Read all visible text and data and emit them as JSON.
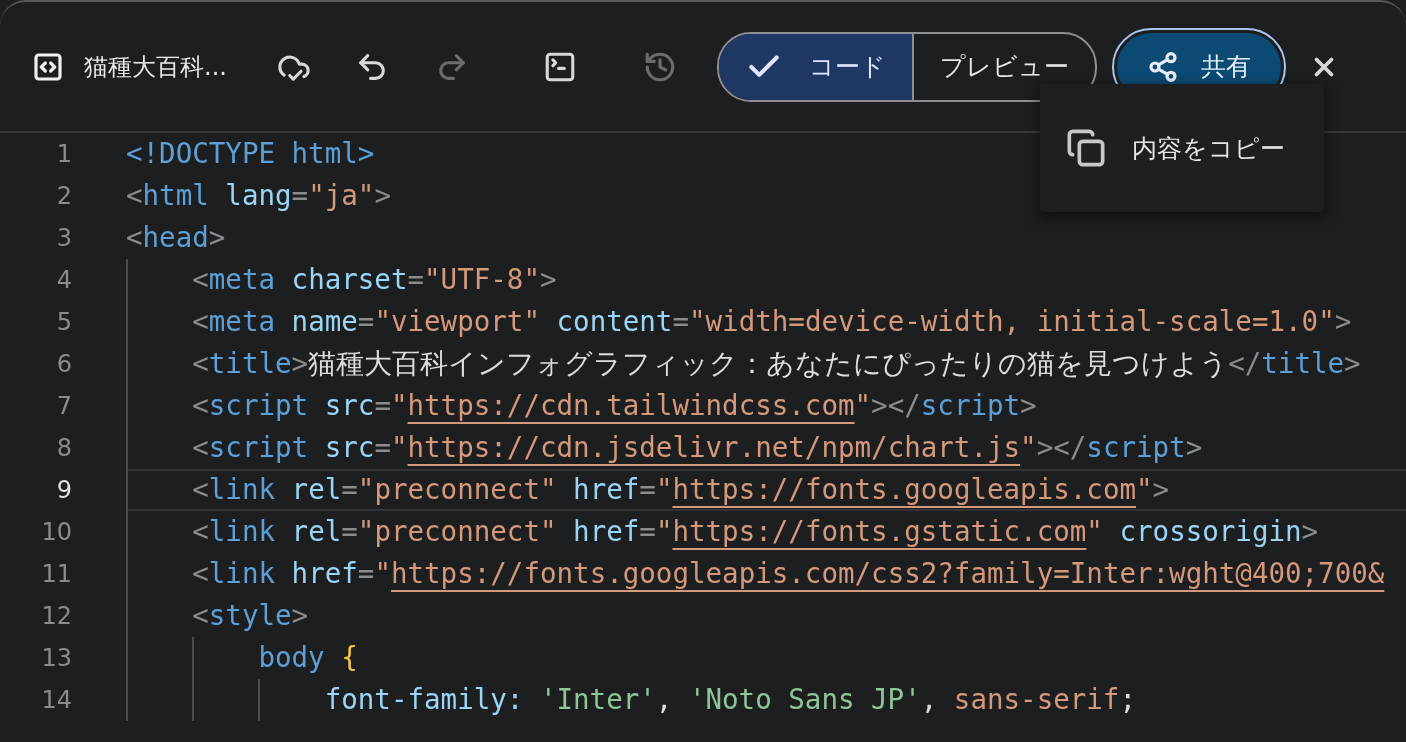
{
  "document": {
    "title": "猫種大百科..."
  },
  "tools": [
    {
      "kind": "cloud",
      "disabled": false
    },
    {
      "kind": "undo",
      "disabled": false
    },
    {
      "kind": "redo",
      "disabled": true
    },
    {
      "kind": "terminal",
      "disabled": false
    },
    {
      "kind": "history",
      "disabled": true
    }
  ],
  "view_tabs": [
    {
      "label": "コード",
      "selected": true
    },
    {
      "label": "プレビュー",
      "selected": false
    }
  ],
  "share_button": {
    "label": "共有"
  },
  "share_menu": {
    "items": [
      {
        "label": "内容をコピー"
      }
    ]
  },
  "code": {
    "lines": [
      {
        "number": "1",
        "current": false,
        "tokens": [
          {
            "kind": "tag",
            "t": "<!DOCTYPE html>"
          }
        ]
      },
      {
        "number": "2",
        "current": false,
        "tokens": [
          {
            "kind": "punct",
            "t": "<"
          },
          {
            "kind": "tag",
            "t": "html"
          },
          {
            "kind": "attr",
            "t": " lang"
          },
          {
            "kind": "punct",
            "t": "="
          },
          {
            "kind": "string",
            "t": "\"ja\""
          },
          {
            "kind": "punct",
            "t": ">"
          }
        ]
      },
      {
        "number": "3",
        "current": false,
        "tokens": [
          {
            "kind": "punct",
            "t": "<"
          },
          {
            "kind": "tag",
            "t": "head"
          },
          {
            "kind": "punct",
            "t": ">"
          }
        ]
      },
      {
        "number": "4",
        "current": false,
        "tokens": [
          {
            "kind": "punct",
            "t": "    <"
          },
          {
            "kind": "tag",
            "t": "meta"
          },
          {
            "kind": "attr",
            "t": " charset"
          },
          {
            "kind": "punct",
            "t": "="
          },
          {
            "kind": "string",
            "t": "\"UTF-8\""
          },
          {
            "kind": "punct",
            "t": ">"
          }
        ]
      },
      {
        "number": "5",
        "current": false,
        "tokens": [
          {
            "kind": "punct",
            "t": "    <"
          },
          {
            "kind": "tag",
            "t": "meta"
          },
          {
            "kind": "attr",
            "t": " name"
          },
          {
            "kind": "punct",
            "t": "="
          },
          {
            "kind": "string",
            "t": "\"viewport\""
          },
          {
            "kind": "attr",
            "t": " content"
          },
          {
            "kind": "punct",
            "t": "="
          },
          {
            "kind": "string",
            "t": "\"width=device-width, initial-scale=1.0\""
          },
          {
            "kind": "punct",
            "t": ">"
          }
        ]
      },
      {
        "number": "6",
        "current": false,
        "tokens": [
          {
            "kind": "punct",
            "t": "    <"
          },
          {
            "kind": "tag",
            "t": "title"
          },
          {
            "kind": "punct",
            "t": ">"
          },
          {
            "kind": "text",
            "t": "猫種大百科インフォグラフィック：あなたにぴったりの猫を見つけよう"
          },
          {
            "kind": "punct",
            "t": "</"
          },
          {
            "kind": "tag",
            "t": "title"
          },
          {
            "kind": "punct",
            "t": ">"
          }
        ]
      },
      {
        "number": "7",
        "current": false,
        "tokens": [
          {
            "kind": "punct",
            "t": "    <"
          },
          {
            "kind": "tag",
            "t": "script"
          },
          {
            "kind": "attr",
            "t": " src"
          },
          {
            "kind": "punct",
            "t": "="
          },
          {
            "kind": "string",
            "t": "\""
          },
          {
            "kind": "link",
            "t": "https://cdn.tailwindcss.com"
          },
          {
            "kind": "string",
            "t": "\""
          },
          {
            "kind": "punct",
            "t": "></"
          },
          {
            "kind": "tag",
            "t": "script"
          },
          {
            "kind": "punct",
            "t": ">"
          }
        ]
      },
      {
        "number": "8",
        "current": false,
        "tokens": [
          {
            "kind": "punct",
            "t": "    <"
          },
          {
            "kind": "tag",
            "t": "script"
          },
          {
            "kind": "attr",
            "t": " src"
          },
          {
            "kind": "punct",
            "t": "="
          },
          {
            "kind": "string",
            "t": "\""
          },
          {
            "kind": "link",
            "t": "https://cdn.jsdelivr.net/npm/chart.js"
          },
          {
            "kind": "string",
            "t": "\""
          },
          {
            "kind": "punct",
            "t": "></"
          },
          {
            "kind": "tag",
            "t": "script"
          },
          {
            "kind": "punct",
            "t": ">"
          }
        ]
      },
      {
        "number": "9",
        "current": true,
        "tokens": [
          {
            "kind": "punct",
            "t": "    <"
          },
          {
            "kind": "tag",
            "t": "link"
          },
          {
            "kind": "attr",
            "t": " rel"
          },
          {
            "kind": "punct",
            "t": "="
          },
          {
            "kind": "string",
            "t": "\"preconnect\""
          },
          {
            "kind": "attr",
            "t": " href"
          },
          {
            "kind": "punct",
            "t": "="
          },
          {
            "kind": "string",
            "t": "\""
          },
          {
            "kind": "link",
            "t": "https://fonts.googleapis.com"
          },
          {
            "kind": "string",
            "t": "\""
          },
          {
            "kind": "punct",
            "t": ">"
          }
        ]
      },
      {
        "number": "10",
        "current": false,
        "tokens": [
          {
            "kind": "punct",
            "t": "    <"
          },
          {
            "kind": "tag",
            "t": "link"
          },
          {
            "kind": "attr",
            "t": " rel"
          },
          {
            "kind": "punct",
            "t": "="
          },
          {
            "kind": "string",
            "t": "\"preconnect\""
          },
          {
            "kind": "attr",
            "t": " href"
          },
          {
            "kind": "punct",
            "t": "="
          },
          {
            "kind": "string",
            "t": "\""
          },
          {
            "kind": "link",
            "t": "https://fonts.gstatic.com"
          },
          {
            "kind": "string",
            "t": "\""
          },
          {
            "kind": "attr",
            "t": " crossorigin"
          },
          {
            "kind": "punct",
            "t": ">"
          }
        ]
      },
      {
        "number": "11",
        "current": false,
        "tokens": [
          {
            "kind": "punct",
            "t": "    <"
          },
          {
            "kind": "tag",
            "t": "link"
          },
          {
            "kind": "attr",
            "t": " href"
          },
          {
            "kind": "punct",
            "t": "="
          },
          {
            "kind": "string",
            "t": "\""
          },
          {
            "kind": "link",
            "t": "https://fonts.googleapis.com/css2?family=Inter:wght@400;700&"
          }
        ]
      },
      {
        "number": "12",
        "current": false,
        "tokens": [
          {
            "kind": "punct",
            "t": "    <"
          },
          {
            "kind": "tag",
            "t": "style"
          },
          {
            "kind": "punct",
            "t": ">"
          }
        ]
      },
      {
        "number": "13",
        "current": false,
        "tokens": [
          {
            "kind": "tag",
            "t": "        body"
          },
          {
            "kind": "brace",
            "t": " {"
          }
        ]
      },
      {
        "number": "14",
        "current": false,
        "tokens": [
          {
            "kind": "attr",
            "t": "            font-family:"
          },
          {
            "kind": "value",
            "t": " 'Inter'"
          },
          {
            "kind": "text",
            "t": ", "
          },
          {
            "kind": "value",
            "t": "'Noto Sans JP'"
          },
          {
            "kind": "text",
            "t": ", "
          },
          {
            "kind": "string",
            "t": "sans-serif"
          },
          {
            "kind": "text",
            "t": ";"
          }
        ]
      }
    ]
  }
}
